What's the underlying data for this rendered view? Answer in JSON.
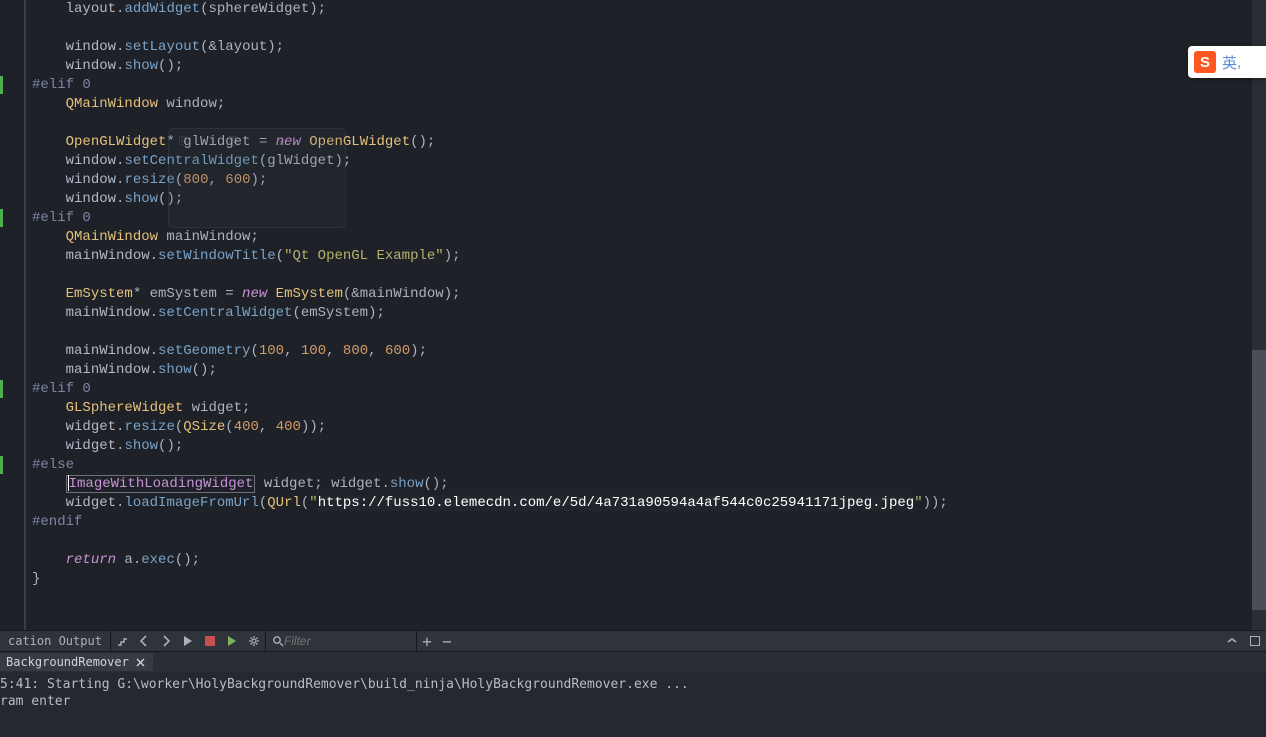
{
  "code_lines": [
    {
      "indent": 2,
      "segs": [
        {
          "t": "layout",
          "c": "c-ident"
        },
        {
          "t": ".",
          "c": "c-punct"
        },
        {
          "t": "addWidget",
          "c": "c-func"
        },
        {
          "t": "(sphereWidget);",
          "c": "c-punct"
        }
      ]
    },
    {
      "indent": 0,
      "segs": []
    },
    {
      "indent": 2,
      "segs": [
        {
          "t": "window",
          "c": "c-ident"
        },
        {
          "t": ".",
          "c": "c-punct"
        },
        {
          "t": "setLayout",
          "c": "c-func"
        },
        {
          "t": "(&layout);",
          "c": "c-punct"
        }
      ]
    },
    {
      "indent": 2,
      "segs": [
        {
          "t": "window",
          "c": "c-ident"
        },
        {
          "t": ".",
          "c": "c-punct"
        },
        {
          "t": "show",
          "c": "c-func"
        },
        {
          "t": "();",
          "c": "c-punct"
        }
      ]
    },
    {
      "indent": 0,
      "mark": true,
      "segs": [
        {
          "t": "#elif 0",
          "c": "c-preproc"
        }
      ]
    },
    {
      "indent": 2,
      "segs": [
        {
          "t": "QMainWindow",
          "c": "c-type"
        },
        {
          "t": " window;",
          "c": "c-punct"
        }
      ]
    },
    {
      "indent": 0,
      "segs": []
    },
    {
      "indent": 2,
      "segs": [
        {
          "t": "OpenGLWidget",
          "c": "c-type"
        },
        {
          "t": "* glWidget = ",
          "c": "c-punct"
        },
        {
          "t": "new",
          "c": "c-keyword"
        },
        {
          "t": " ",
          "c": "c-punct"
        },
        {
          "t": "OpenGLWidget",
          "c": "c-type"
        },
        {
          "t": "();",
          "c": "c-punct"
        }
      ]
    },
    {
      "indent": 2,
      "segs": [
        {
          "t": "window",
          "c": "c-ident"
        },
        {
          "t": ".",
          "c": "c-punct"
        },
        {
          "t": "setCentralWidget",
          "c": "c-func"
        },
        {
          "t": "(glWidget);",
          "c": "c-punct"
        }
      ]
    },
    {
      "indent": 2,
      "segs": [
        {
          "t": "window",
          "c": "c-ident"
        },
        {
          "t": ".",
          "c": "c-punct"
        },
        {
          "t": "resize",
          "c": "c-func"
        },
        {
          "t": "(",
          "c": "c-punct"
        },
        {
          "t": "800",
          "c": "c-num"
        },
        {
          "t": ", ",
          "c": "c-punct"
        },
        {
          "t": "600",
          "c": "c-num"
        },
        {
          "t": ");",
          "c": "c-punct"
        }
      ]
    },
    {
      "indent": 2,
      "segs": [
        {
          "t": "window",
          "c": "c-ident"
        },
        {
          "t": ".",
          "c": "c-punct"
        },
        {
          "t": "show",
          "c": "c-func"
        },
        {
          "t": "();",
          "c": "c-punct"
        }
      ]
    },
    {
      "indent": 0,
      "mark": true,
      "segs": [
        {
          "t": "#elif 0",
          "c": "c-preproc"
        }
      ]
    },
    {
      "indent": 2,
      "segs": [
        {
          "t": "QMainWindow",
          "c": "c-type"
        },
        {
          "t": " mainWindow;",
          "c": "c-punct"
        }
      ]
    },
    {
      "indent": 2,
      "segs": [
        {
          "t": "mainWindow",
          "c": "c-ident"
        },
        {
          "t": ".",
          "c": "c-punct"
        },
        {
          "t": "setWindowTitle",
          "c": "c-func"
        },
        {
          "t": "(",
          "c": "c-punct"
        },
        {
          "t": "\"Qt OpenGL Example\"",
          "c": "c-string"
        },
        {
          "t": ");",
          "c": "c-punct"
        }
      ]
    },
    {
      "indent": 0,
      "segs": []
    },
    {
      "indent": 2,
      "segs": [
        {
          "t": "EmSystem",
          "c": "c-type"
        },
        {
          "t": "* emSystem = ",
          "c": "c-punct"
        },
        {
          "t": "new",
          "c": "c-keyword"
        },
        {
          "t": " ",
          "c": "c-punct"
        },
        {
          "t": "EmSystem",
          "c": "c-type"
        },
        {
          "t": "(&mainWindow);",
          "c": "c-punct"
        }
      ]
    },
    {
      "indent": 2,
      "segs": [
        {
          "t": "mainWindow",
          "c": "c-ident"
        },
        {
          "t": ".",
          "c": "c-punct"
        },
        {
          "t": "setCentralWidget",
          "c": "c-func"
        },
        {
          "t": "(emSystem);",
          "c": "c-punct"
        }
      ]
    },
    {
      "indent": 0,
      "segs": []
    },
    {
      "indent": 2,
      "segs": [
        {
          "t": "mainWindow",
          "c": "c-ident"
        },
        {
          "t": ".",
          "c": "c-punct"
        },
        {
          "t": "setGeometry",
          "c": "c-func"
        },
        {
          "t": "(",
          "c": "c-punct"
        },
        {
          "t": "100",
          "c": "c-num"
        },
        {
          "t": ", ",
          "c": "c-punct"
        },
        {
          "t": "100",
          "c": "c-num"
        },
        {
          "t": ", ",
          "c": "c-punct"
        },
        {
          "t": "800",
          "c": "c-num"
        },
        {
          "t": ", ",
          "c": "c-punct"
        },
        {
          "t": "600",
          "c": "c-num"
        },
        {
          "t": ");",
          "c": "c-punct"
        }
      ]
    },
    {
      "indent": 2,
      "segs": [
        {
          "t": "mainWindow",
          "c": "c-ident"
        },
        {
          "t": ".",
          "c": "c-punct"
        },
        {
          "t": "show",
          "c": "c-func"
        },
        {
          "t": "();",
          "c": "c-punct"
        }
      ]
    },
    {
      "indent": 0,
      "mark": true,
      "segs": [
        {
          "t": "#elif 0",
          "c": "c-preproc"
        }
      ]
    },
    {
      "indent": 2,
      "segs": [
        {
          "t": "GLSphereWidget",
          "c": "c-type"
        },
        {
          "t": " widget;",
          "c": "c-punct"
        }
      ]
    },
    {
      "indent": 2,
      "segs": [
        {
          "t": "widget",
          "c": "c-ident"
        },
        {
          "t": ".",
          "c": "c-punct"
        },
        {
          "t": "resize",
          "c": "c-func"
        },
        {
          "t": "(",
          "c": "c-punct"
        },
        {
          "t": "QSize",
          "c": "c-type"
        },
        {
          "t": "(",
          "c": "c-punct"
        },
        {
          "t": "400",
          "c": "c-num"
        },
        {
          "t": ", ",
          "c": "c-punct"
        },
        {
          "t": "400",
          "c": "c-num"
        },
        {
          "t": "));",
          "c": "c-punct"
        }
      ]
    },
    {
      "indent": 2,
      "segs": [
        {
          "t": "widget",
          "c": "c-ident"
        },
        {
          "t": ".",
          "c": "c-punct"
        },
        {
          "t": "show",
          "c": "c-func"
        },
        {
          "t": "();",
          "c": "c-punct"
        }
      ]
    },
    {
      "indent": 0,
      "mark": true,
      "segs": [
        {
          "t": "#else",
          "c": "c-preproc"
        }
      ]
    },
    {
      "indent": 2,
      "special": "selected_line"
    },
    {
      "indent": 2,
      "segs": [
        {
          "t": "widget",
          "c": "c-ident"
        },
        {
          "t": ".",
          "c": "c-punct"
        },
        {
          "t": "loadImageFromUrl",
          "c": "c-func"
        },
        {
          "t": "(",
          "c": "c-punct"
        },
        {
          "t": "QUrl",
          "c": "c-type"
        },
        {
          "t": "(",
          "c": "c-punct"
        },
        {
          "t": "\"",
          "c": "c-string"
        },
        {
          "t": "https://fuss10.elemecdn.com/e/5d/4a731a90594a4af544c0c25941171jpeg.jpeg",
          "c": "c-url"
        },
        {
          "t": "\"",
          "c": "c-string"
        },
        {
          "t": "));",
          "c": "c-punct"
        }
      ]
    },
    {
      "indent": 0,
      "segs": [
        {
          "t": "#endif",
          "c": "c-preproc"
        }
      ]
    },
    {
      "indent": 0,
      "segs": []
    },
    {
      "indent": 2,
      "segs": [
        {
          "t": "return",
          "c": "c-keyword"
        },
        {
          "t": " a.",
          "c": "c-punct"
        },
        {
          "t": "exec",
          "c": "c-func"
        },
        {
          "t": "();",
          "c": "c-punct"
        }
      ]
    },
    {
      "indent": 0,
      "segs": [
        {
          "t": "}",
          "c": "c-punct"
        }
      ]
    }
  ],
  "selected_token": "ImageWithLoadingWidget",
  "selected_rest": " widget; widget.show();",
  "ime": {
    "logo": "S",
    "lang": "英",
    "trail": ","
  },
  "ghost_popup": [
    "",
    ""
  ],
  "panel": {
    "title": "cation Output",
    "filter_placeholder": "Filter"
  },
  "tab": {
    "label": "BackgroundRemover"
  },
  "output_lines": [
    "5:41: Starting G:\\worker\\HolyBackgroundRemover\\build_ninja\\HolyBackgroundRemover.exe ...",
    "ram enter"
  ]
}
